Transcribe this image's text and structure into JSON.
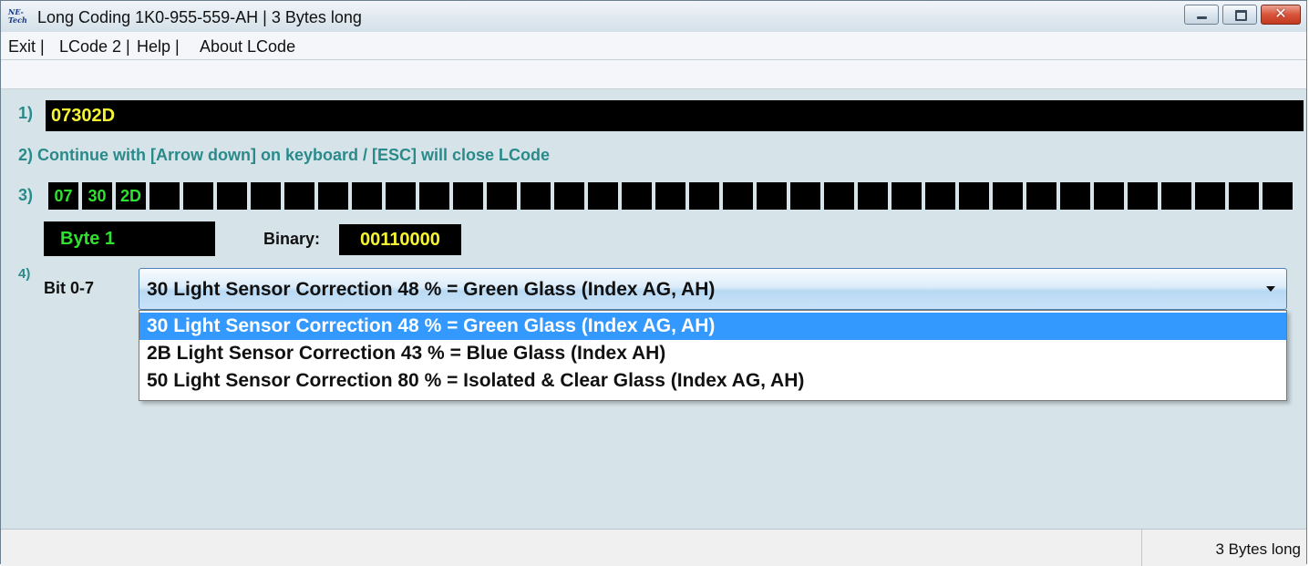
{
  "window": {
    "title": "Long Coding  1K0-955-559-AH | 3 Bytes long",
    "icon_text_top": "NE-",
    "icon_text_bottom": "Tech",
    "icon_name": "ne-tech-logo-icon",
    "min_icon": "minimize-icon",
    "max_icon": "maximize-icon",
    "close_icon": "close-icon",
    "close_glyph": "✕"
  },
  "menu": {
    "items": [
      {
        "label": "Exit |"
      },
      {
        "label": "LCode 2 |"
      },
      {
        "label": "Help |"
      },
      {
        "label": "About LCode"
      }
    ]
  },
  "step1": {
    "number": "1)",
    "value": "07302D"
  },
  "step2": {
    "text": "2) Continue with [Arrow down] on keyboard / [ESC] will close LCode"
  },
  "step3": {
    "number": "3)",
    "bytes": [
      "07",
      "30",
      "2D",
      "",
      "",
      "",
      "",
      "",
      "",
      "",
      "",
      "",
      "",
      "",
      "",
      "",
      "",
      "",
      "",
      "",
      "",
      "",
      "",
      "",
      "",
      "",
      "",
      "",
      "",
      "",
      "",
      "",
      "",
      "",
      "",
      "",
      "",
      "",
      "",
      ""
    ],
    "byte_label": "Byte 1",
    "binary_label": "Binary:",
    "binary_value": "00110000"
  },
  "step4": {
    "number": "4)",
    "bit_label": "Bit 0-7",
    "selected": "30 Light Sensor Correction 48 % = Green Glass (Index AG, AH)",
    "dropdown_icon": "dropdown-arrow-icon",
    "options": [
      {
        "label": "30 Light Sensor Correction 48 % = Green Glass (Index AG, AH)",
        "selected": true
      },
      {
        "label": "2B Light Sensor Correction 43 % = Blue Glass (Index AH)",
        "selected": false
      },
      {
        "label": "50 Light Sensor Correction 80 % = Isolated & Clear Glass (Index AG, AH)",
        "selected": false
      }
    ]
  },
  "status": {
    "text": "3 Bytes long"
  },
  "colors": {
    "background": "#d6e4ea",
    "label_teal": "#2a8a8a",
    "value_yellow": "#f5f531",
    "byte_green": "#2fe22f",
    "selection_blue": "#3399ff"
  }
}
